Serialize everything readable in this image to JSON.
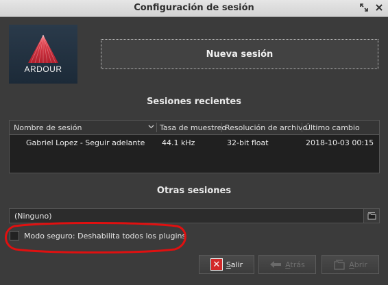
{
  "window": {
    "title": "Configuración de sesión"
  },
  "logo": {
    "text": "ARDOUR"
  },
  "new_session": {
    "label": "Nueva sesión"
  },
  "recent": {
    "heading": "Sesiones recientes",
    "columns": [
      "Nombre de sesión",
      "Tasa de muestreo",
      "Resolución de archivo",
      "Último cambio"
    ],
    "rows": [
      {
        "name": "Gabriel Lopez  - Seguir adelante",
        "rate": "44.1 kHz",
        "resolution": "32-bit float",
        "modified": "2018-10-03 00:15"
      }
    ]
  },
  "other": {
    "heading": "Otras sesiones",
    "selected": "(Ninguno)"
  },
  "safe_mode": {
    "label": "Modo seguro: Deshabilita todos los plugins",
    "checked": false
  },
  "buttons": {
    "quit_first": "S",
    "quit_rest": "alir",
    "back_first": "A",
    "back_rest": "trás",
    "open_first": "A",
    "open_rest": "brir"
  },
  "colors": {
    "annotation": "#e01010",
    "quit_icon": "#d22a2a",
    "logo_accent": "#e8313e"
  },
  "icons": {
    "quit": "close-icon",
    "back": "arrow-left-icon",
    "open": "open-folder-icon",
    "combo": "folder-icon",
    "sort": "chevron-down-icon"
  }
}
